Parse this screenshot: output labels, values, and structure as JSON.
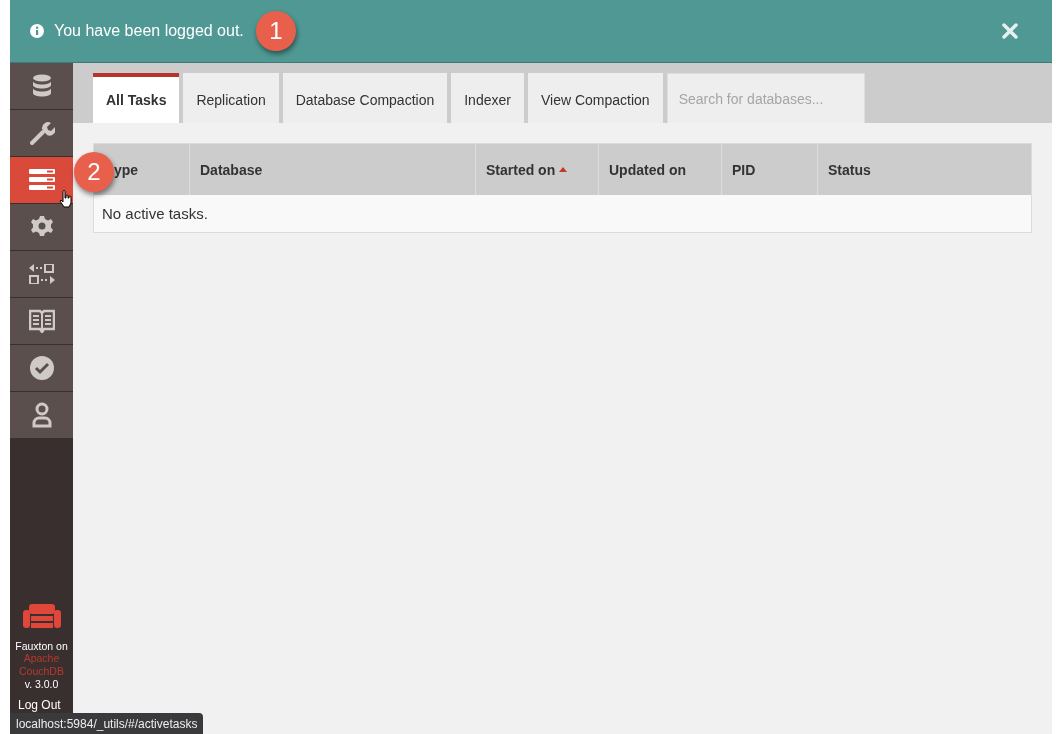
{
  "banner": {
    "message": "You have been logged out."
  },
  "callouts": [
    {
      "number": "1"
    },
    {
      "number": "2"
    }
  ],
  "sidebar": {
    "items": [
      {
        "kind": "databases",
        "selected": false
      },
      {
        "kind": "setup",
        "selected": false
      },
      {
        "kind": "tasks",
        "selected": true
      },
      {
        "kind": "config",
        "selected": false
      },
      {
        "kind": "replication",
        "selected": false
      },
      {
        "kind": "docs",
        "selected": false
      },
      {
        "kind": "verify",
        "selected": false
      },
      {
        "kind": "user",
        "selected": false
      }
    ],
    "footer": {
      "product": "Fauxton on",
      "link": "Apache CouchDB",
      "version": "v. 3.0.0",
      "logout": "Log Out"
    }
  },
  "tabs": [
    {
      "label": "All Tasks",
      "selected": true
    },
    {
      "label": "Replication",
      "selected": false
    },
    {
      "label": "Database Compaction",
      "selected": false
    },
    {
      "label": "Indexer",
      "selected": false
    },
    {
      "label": "View Compaction",
      "selected": false
    }
  ],
  "search": {
    "placeholder": "Search for databases..."
  },
  "table": {
    "columns": [
      {
        "label": "ype",
        "sorted": false
      },
      {
        "label": "Database",
        "sorted": false
      },
      {
        "label": "Started on",
        "sorted": true
      },
      {
        "label": "Updated on",
        "sorted": false
      },
      {
        "label": "PID",
        "sorted": false
      },
      {
        "label": "Status",
        "sorted": false
      }
    ],
    "empty_message": "No active tasks."
  },
  "status_bar": {
    "url": "localhost:5984/_utils/#/activetasks"
  }
}
